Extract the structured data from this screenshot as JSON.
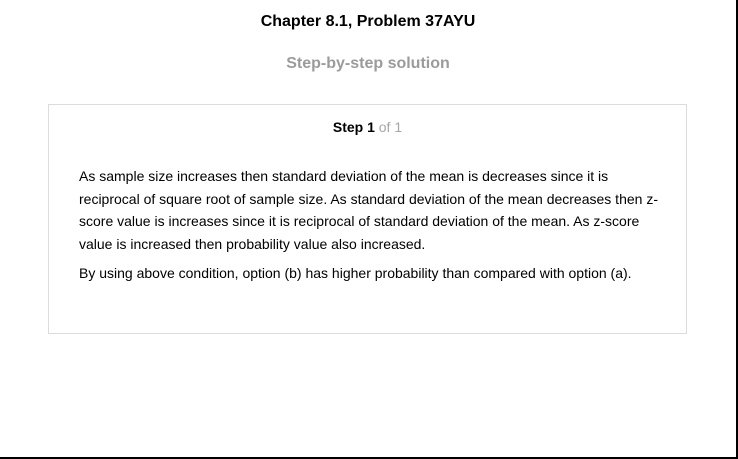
{
  "header": {
    "chapter_title": "Chapter 8.1, Problem 37AYU",
    "subtitle": "Step-by-step solution"
  },
  "step": {
    "label": "Step 1",
    "total": "of 1",
    "paragraphs": [
      "As sample size increases then standard deviation of the mean is decreases since it is reciprocal of square root of sample size. As standard deviation of the mean decreases then z-score value is increases since it is reciprocal of standard deviation of the mean. As z-score value is increased then probability value also increased.",
      "By using above condition, option (b) has higher probability than compared with option (a)."
    ]
  }
}
